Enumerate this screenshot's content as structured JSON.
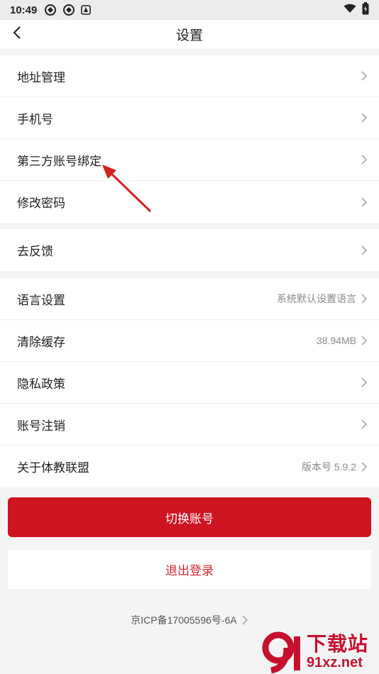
{
  "status_bar": {
    "time": "10:49"
  },
  "nav": {
    "title": "设置"
  },
  "group1": [
    {
      "label": "地址管理"
    },
    {
      "label": "手机号"
    },
    {
      "label": "第三方账号绑定"
    },
    {
      "label": "修改密码"
    }
  ],
  "group2": [
    {
      "label": "去反馈"
    }
  ],
  "group3": [
    {
      "label": "语言设置",
      "value": "系统默认设置语言"
    },
    {
      "label": "清除缓存",
      "value": "38.94MB"
    },
    {
      "label": "隐私政策",
      "value": ""
    },
    {
      "label": "账号注销",
      "value": ""
    },
    {
      "label": "关于体教联盟",
      "value": "版本号 5.9.2"
    }
  ],
  "buttons": {
    "switch_account": "切换账号",
    "logout": "退出登录"
  },
  "footer": {
    "icp": "京ICP备17005596号-6A"
  },
  "watermark": {
    "title": "下载站",
    "site": "91xz.net"
  },
  "colors": {
    "primary_red": "#cf1422",
    "logout_red": "#d9232e",
    "annotation": "#d42020"
  }
}
